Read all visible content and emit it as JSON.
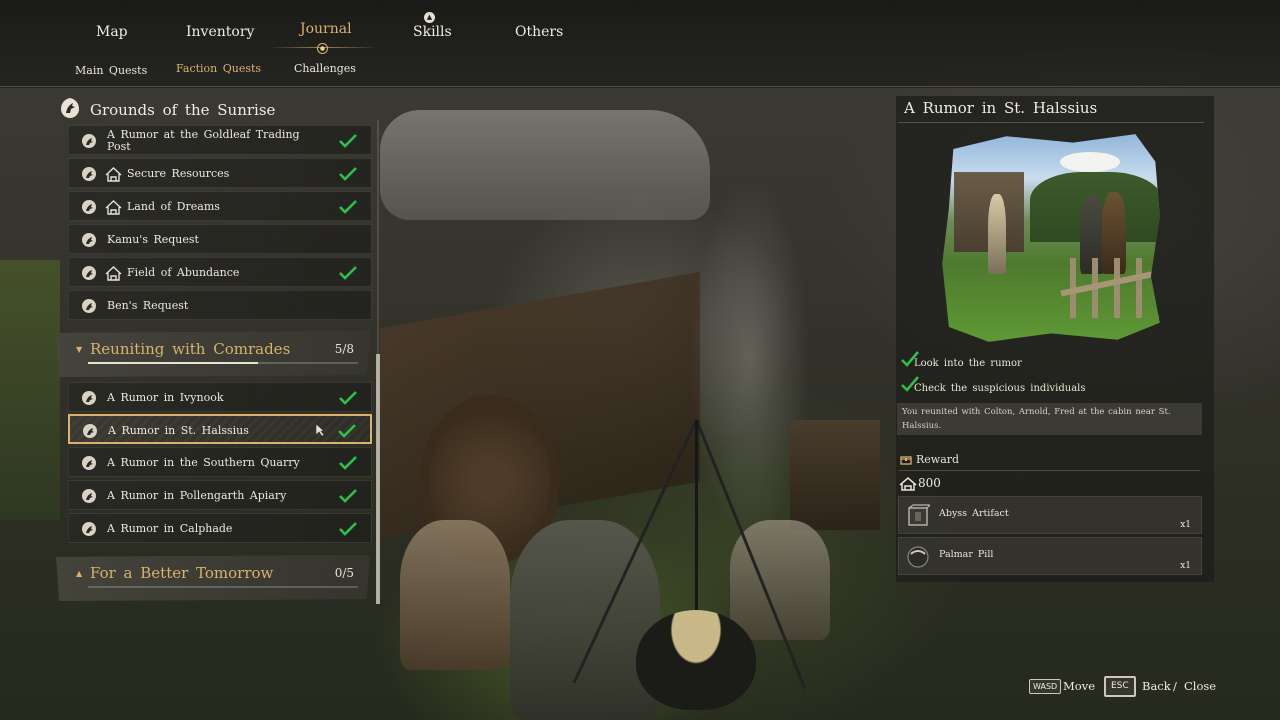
{
  "nav": {
    "tabs": [
      {
        "label": "Map",
        "active": false
      },
      {
        "label": "Inventory",
        "active": false
      },
      {
        "label": "Journal",
        "active": true
      },
      {
        "label": "Skills",
        "active": false,
        "badge_icon": "circle-arrow-up-icon"
      },
      {
        "label": "Others",
        "active": false
      }
    ],
    "subtabs": [
      {
        "label": "Main Quests",
        "active": false
      },
      {
        "label": "Faction Quests",
        "active": true
      },
      {
        "label": "Challenges",
        "active": false
      }
    ]
  },
  "quest_list": {
    "region": {
      "title": "Grounds of the Sunrise",
      "icon": "horse-head-emblem-icon"
    },
    "region_quests": [
      {
        "label": "A Rumor at the Goldleaf Trading Post",
        "completed": true,
        "has_house_icon": false
      },
      {
        "label": "Secure Resources",
        "completed": true,
        "has_house_icon": true
      },
      {
        "label": "Land of Dreams",
        "completed": true,
        "has_house_icon": false
      },
      {
        "label": "Kamu's Request",
        "completed": false,
        "has_house_icon": false
      },
      {
        "label": "Field of Abundance",
        "completed": true,
        "has_house_icon": true
      },
      {
        "label": "Ben's Request",
        "completed": false,
        "has_house_icon": false
      }
    ],
    "groups": [
      {
        "title": "Reuniting with Comrades",
        "expanded": true,
        "progress_text": "5/8",
        "progress": 0.625,
        "quests": [
          {
            "label": "A Rumor in Ivynook",
            "completed": true,
            "selected": false
          },
          {
            "label": "A Rumor in St. Halssius",
            "completed": true,
            "selected": true
          },
          {
            "label": "A Rumor in the Southern Quarry",
            "completed": true,
            "selected": false
          },
          {
            "label": "A Rumor in Pollengarth Apiary",
            "completed": true,
            "selected": false
          },
          {
            "label": "A Rumor in Calphade",
            "completed": true,
            "selected": false
          }
        ]
      },
      {
        "title": "For a Better Tomorrow",
        "expanded": false,
        "progress_text": "0/5",
        "progress": 0
      }
    ]
  },
  "detail": {
    "title": "A Rumor in St. Halssius",
    "objectives": [
      {
        "text": "Look into the rumor",
        "done": true
      },
      {
        "text": "Check the suspicious individuals",
        "done": true
      }
    ],
    "summary": "You reunited with Colton, Arnold, Fred at the cabin near St. Halssius.",
    "reward": {
      "label": "Reward",
      "points": "800",
      "items": [
        {
          "name": "Abyss Artifact",
          "qty": "x1",
          "icon": "artifact-box-icon"
        },
        {
          "name": "Palmar Pill",
          "qty": "x1",
          "icon": "pill-icon"
        }
      ]
    }
  },
  "footer": {
    "move_key": "WASD",
    "move_label": "Move",
    "back_key": "ESC",
    "back_label": "Back",
    "slash": "/",
    "close_label": "Close"
  },
  "colors": {
    "accent_gold": "#d9b26e",
    "check_green": "#2fbf4a",
    "text": "#f0ece2"
  }
}
